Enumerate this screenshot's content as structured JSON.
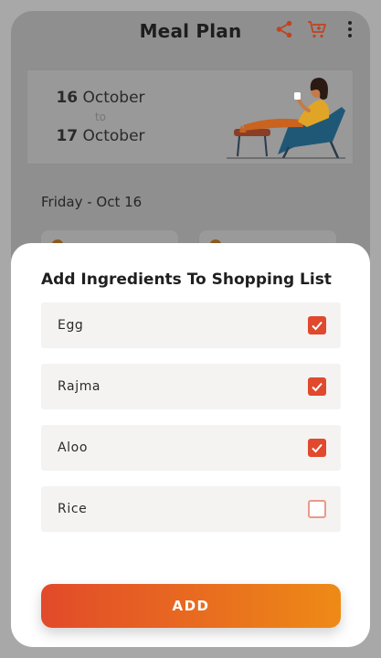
{
  "header": {
    "title": "Meal Plan",
    "icons": [
      "share-icon",
      "cart-icon",
      "more-vertical-icon"
    ]
  },
  "date_range": {
    "start_day": "16",
    "start_month": "October",
    "separator": "to",
    "end_day": "17",
    "end_month": "October"
  },
  "day_label": "Friday - Oct 16",
  "sheet": {
    "title": "Add Ingredients To Shopping List",
    "items": [
      {
        "label": "Egg",
        "checked": true
      },
      {
        "label": "Rajma",
        "checked": true
      },
      {
        "label": "Aloo",
        "checked": true
      },
      {
        "label": "Rice",
        "checked": false
      }
    ],
    "add_label": "ADD"
  },
  "colors": {
    "accent": "#e0492d",
    "button_gradient_start": "#e24a2a",
    "button_gradient_end": "#ee8a16"
  }
}
